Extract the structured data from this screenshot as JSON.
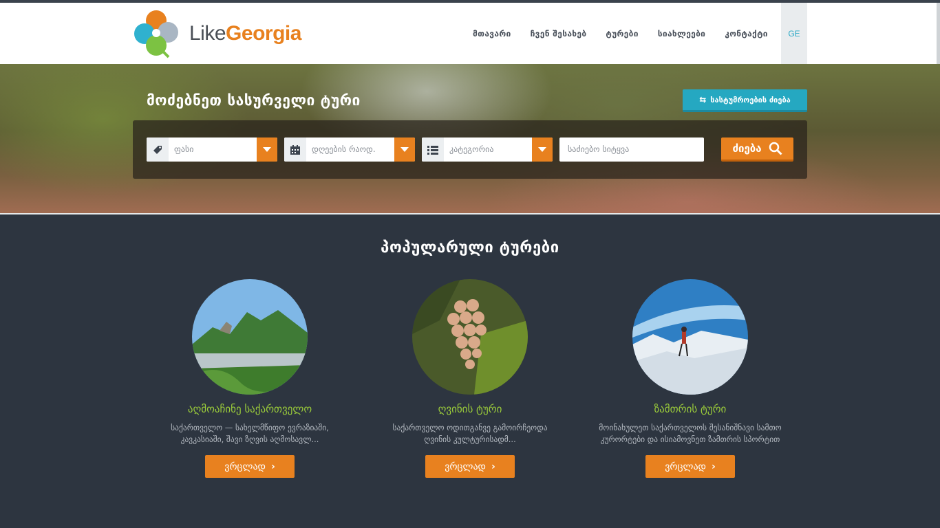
{
  "brand": {
    "like": "Like",
    "georgia": "Georgia",
    "accent": "#e8811f"
  },
  "nav": {
    "items": [
      "მთავარი",
      "ჩვენ შესახებ",
      "ტურები",
      "სიახლეები",
      "კონტაქტი"
    ],
    "lang": "GE"
  },
  "hero": {
    "title": "მოძებნეთ სასურველი ტური",
    "advanced_search": "სასტუმროების ძიება",
    "price_placeholder": "ფასი",
    "days_placeholder": "დღეების რაოდ.",
    "category_placeholder": "კატეგორია",
    "keyword_placeholder": "საძიებო სიტყვა",
    "search_label": "ძიება"
  },
  "popular": {
    "title": "პოპულარული ტურები",
    "tours": [
      {
        "title": "აღმოაჩინე საქართველო",
        "desc1": "საქართველო — სახელმწიფო ევრაზიაში,",
        "desc2": "კავკასიაში, შავი ზღვის აღმოსავლ...",
        "button": "ვრცლად"
      },
      {
        "title": "ღვინის ტური",
        "desc1": "საქართველო ოდითგანვე გამოირჩეოდა",
        "desc2": "ღვინის კულტურისადმ...",
        "button": "ვრცლად"
      },
      {
        "title": "ზამთრის ტური",
        "desc1": "მოინახულეთ საქართველოს შესანიშნავი სამთო",
        "desc2": "კურორტები და ისიამოვნეთ ზამთრის სპორტით",
        "button": "ვრცლად"
      }
    ]
  },
  "colors": {
    "title_green": "#9bcc3a",
    "button_orange": "#e8811f",
    "teal": "#25a8c1",
    "dark_bg": "#2d3540"
  }
}
